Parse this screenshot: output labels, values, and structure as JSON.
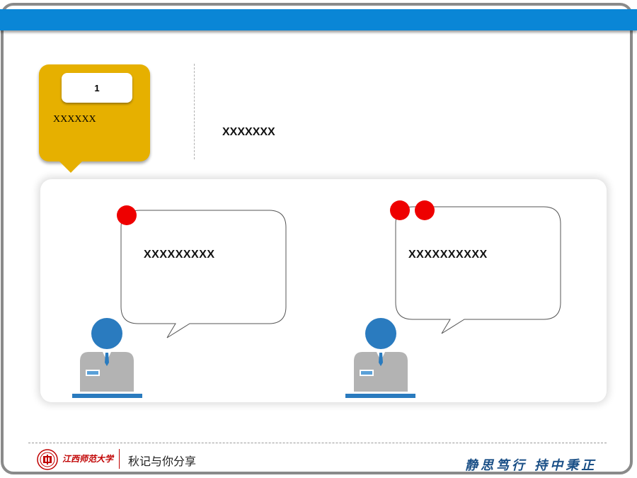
{
  "card": {
    "number": "1",
    "label": "XXXXXX"
  },
  "side_text": "XXXXXXX",
  "bubbles": [
    {
      "text": "XXXXXXXXX"
    },
    {
      "text": "XXXXXXXXXX"
    }
  ],
  "footer": {
    "university": "江西师范大学",
    "slogan": "秋记与你分享",
    "motto": "静思笃行 持中秉正"
  },
  "colors": {
    "accent_bar": "#0a86d6",
    "card": "#e6b000",
    "dot": "#ee0000",
    "person_head": "#2a7bbf",
    "motto": "#1a4f86",
    "brand_red": "#c00000"
  },
  "icons": [
    "person-icon",
    "university-logo"
  ]
}
